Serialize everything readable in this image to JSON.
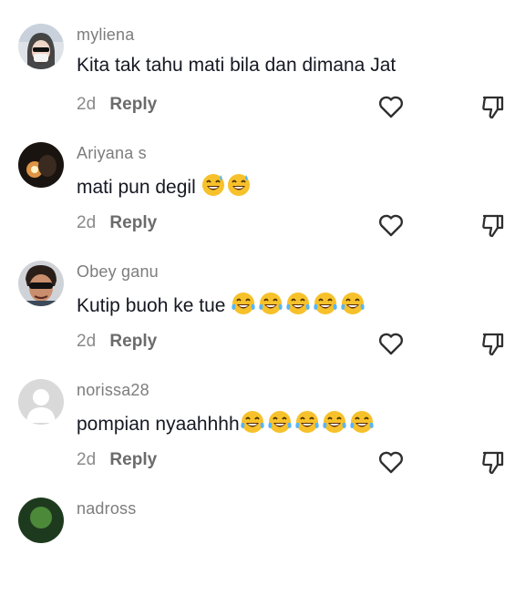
{
  "comments": [
    {
      "username": "myliena",
      "text": "Kita tak tahu mati bila dan dimana Jat",
      "time": "2d",
      "reply": "Reply",
      "emoji_count": 0,
      "avatar": "avatar-woman-masked"
    },
    {
      "username": "Ariyana s",
      "text": "mati pun degil",
      "time": "2d",
      "reply": "Reply",
      "emoji_count": 2,
      "emoji": "laughing-sweat-emoji",
      "avatar": "avatar-dark-candle"
    },
    {
      "username": "Obey ganu",
      "text": "Kutip buoh ke tue",
      "time": "2d",
      "reply": "Reply",
      "emoji_count": 5,
      "emoji": "tears-of-joy-emoji",
      "avatar": "avatar-man-sunglasses"
    },
    {
      "username": "norissa28",
      "text": "pompian nyaahhhh",
      "time": "2d",
      "reply": "Reply",
      "emoji_count": 5,
      "emoji": "tears-of-joy-emoji",
      "avatar": "avatar-default"
    },
    {
      "username": "nadross",
      "avatar": "avatar-green"
    }
  ],
  "colors": {
    "username": "#7d7d7d",
    "text": "#161823",
    "meta": "#8a8a8a",
    "icon": "#2f2f2f",
    "emoji": "#f7c12b"
  }
}
